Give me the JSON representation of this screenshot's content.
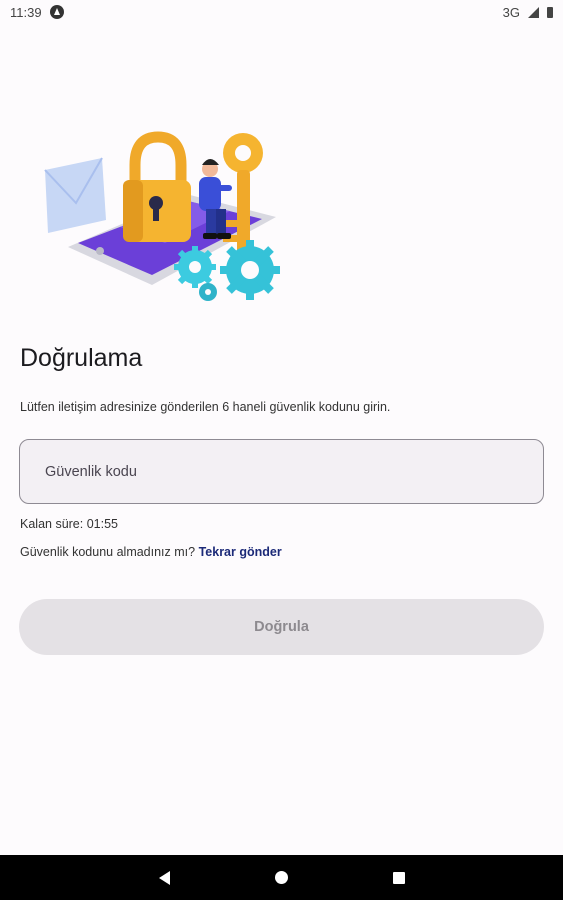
{
  "status_bar": {
    "time": "11:39",
    "network": "3G",
    "icons": [
      "notification-icon",
      "signal-icon",
      "battery-icon"
    ]
  },
  "illustration": {
    "icon": "security-lock-key-illustration",
    "colors": {
      "lock": "#f5b430",
      "gears": "#35c2d8",
      "phone_screen": "#6b3fd8",
      "envelope": "#c7d7f5",
      "person_shirt": "#3a4fd8"
    }
  },
  "verification": {
    "title": "Doğrulama",
    "description": "Lütfen iletişim adresinize gönderilen 6 haneli güvenlik kodunu girin.",
    "code_field": {
      "placeholder": "Güvenlik kodu",
      "value": ""
    },
    "timer_text": "Kalan süre: 01:55",
    "resend_prompt": "Güvenlik kodunu almadınız mı?",
    "resend_link": "Tekrar gönder",
    "verify_button": "Doğrula"
  },
  "nav_bar": {
    "icons": [
      "back-icon",
      "home-icon",
      "recents-icon"
    ]
  },
  "colors": {
    "background": "#fdfbfd",
    "link": "#1c2a78",
    "button_disabled_bg": "#e4e1e5",
    "button_disabled_text": "#8d8a8f"
  }
}
